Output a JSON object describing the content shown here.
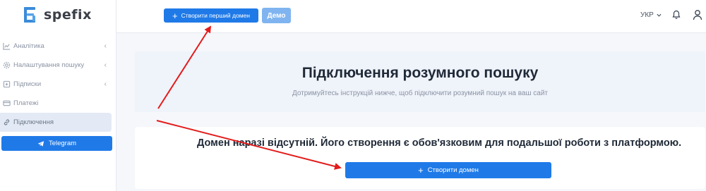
{
  "brand": {
    "name": "spefix"
  },
  "sidebar": {
    "items": [
      {
        "label": "Аналітика",
        "icon": "chart-icon",
        "has_chevron": true
      },
      {
        "label": "Налаштування пошуку",
        "icon": "gear-icon",
        "has_chevron": true
      },
      {
        "label": "Підписки",
        "icon": "subscription-icon",
        "has_chevron": true
      },
      {
        "label": "Платежі",
        "icon": "card-icon",
        "has_chevron": false
      },
      {
        "label": "Підключення",
        "icon": "link-icon",
        "has_chevron": false,
        "active": true
      }
    ],
    "telegram_label": "Telegram"
  },
  "topbar": {
    "create_first_domain_label": "Створити перший домен",
    "demo_label": "Демо",
    "language": "УКР"
  },
  "main": {
    "title": "Підключення розумного пошуку",
    "subtitle": "Дотримуйтесь інструкцій нижче, щоб підключити розумний пошук на ваш сайт",
    "domain_message": "Домен наразі відсутній. Його створення є обов'язковим для подальшої роботи з платформою.",
    "create_domain_label": "Створити домен"
  },
  "colors": {
    "accent": "#1f7ae8",
    "demo": "#7fb4f0",
    "annotation_arrow": "#e31b1b",
    "active_nav_bg": "#e3eaf5"
  }
}
